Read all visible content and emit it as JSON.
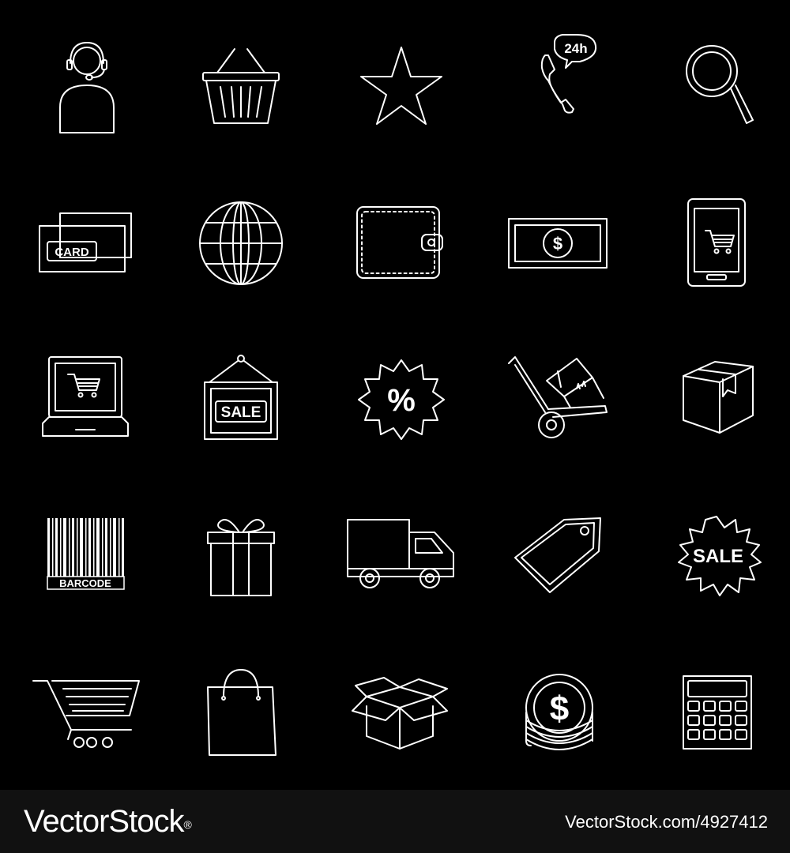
{
  "icons": [
    {
      "name": "customer-support-icon"
    },
    {
      "name": "shopping-basket-icon"
    },
    {
      "name": "star-icon"
    },
    {
      "name": "phone-24h-icon",
      "label": "24h"
    },
    {
      "name": "magnifier-icon"
    },
    {
      "name": "credit-card-icon",
      "label": "CARD"
    },
    {
      "name": "globe-icon"
    },
    {
      "name": "wallet-icon"
    },
    {
      "name": "dollar-banknote-icon",
      "label": "$"
    },
    {
      "name": "mobile-shopping-cart-icon"
    },
    {
      "name": "laptop-shopping-cart-icon"
    },
    {
      "name": "hanging-sale-sign-icon",
      "label": "SALE"
    },
    {
      "name": "percent-badge-icon",
      "label": "%"
    },
    {
      "name": "hand-truck-box-icon"
    },
    {
      "name": "cardboard-box-icon"
    },
    {
      "name": "barcode-icon",
      "label": "BARCODE"
    },
    {
      "name": "gift-box-icon"
    },
    {
      "name": "delivery-truck-icon"
    },
    {
      "name": "price-tag-icon"
    },
    {
      "name": "sale-badge-icon",
      "label": "SALE"
    },
    {
      "name": "shopping-cart-icon"
    },
    {
      "name": "shopping-bag-icon"
    },
    {
      "name": "open-box-icon"
    },
    {
      "name": "coin-stack-icon",
      "label": "$"
    },
    {
      "name": "calculator-icon"
    }
  ],
  "footer": {
    "brand": "VectorStock",
    "brand_mark": "®",
    "image_id": "VectorStock.com/4927412"
  },
  "colors": {
    "background": "#000000",
    "line": "#ffffff",
    "footer_bg": "#111111"
  }
}
